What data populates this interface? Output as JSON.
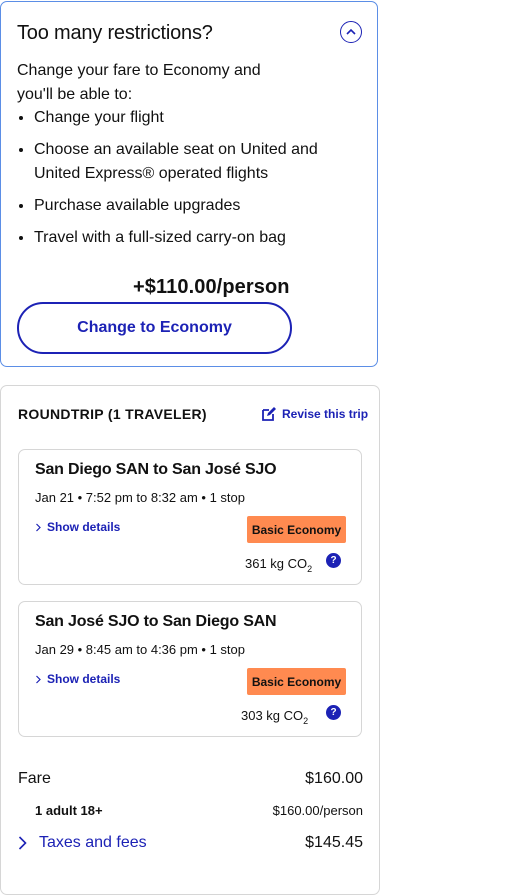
{
  "upsell": {
    "title": "Too many restrictions?",
    "intro": "Change your fare to Economy and you'll be able to:",
    "benefits": [
      "Change your flight",
      "Choose an available seat on United and United Express® operated flights",
      "Purchase available upgrades",
      "Travel with a full-sized carry-on bag"
    ],
    "price": "+$110.00/person",
    "cta_label": "Change to Economy"
  },
  "summary": {
    "title": "ROUNDTRIP (1 TRAVELER)",
    "revise_label": "Revise this trip",
    "flights": [
      {
        "route": "San Diego SAN to San José SJO",
        "times": "Jan 21 • 7:52 pm to 8:32 am • 1 stop",
        "details_label": "Show details",
        "fare_class": "Basic Economy",
        "co2_value": "361 kg CO",
        "co2_sub": "2",
        "help": "?"
      },
      {
        "route": "San José SJO to San Diego SAN",
        "times": "Jan 29 • 8:45 am to 4:36 pm • 1 stop",
        "details_label": "Show details",
        "fare_class": "Basic Economy",
        "co2_value": "303 kg CO",
        "co2_sub": "2",
        "help": "?"
      }
    ],
    "fare_label": "Fare",
    "fare_value": "$160.00",
    "adult_label": "1 adult 18+",
    "adult_value": "$160.00/person",
    "taxes_label": "Taxes and fees",
    "taxes_value": "$145.45"
  },
  "colors": {
    "accent": "#1c22b5",
    "badge": "#ff8a50",
    "panel_border": "#5b8ee6"
  }
}
